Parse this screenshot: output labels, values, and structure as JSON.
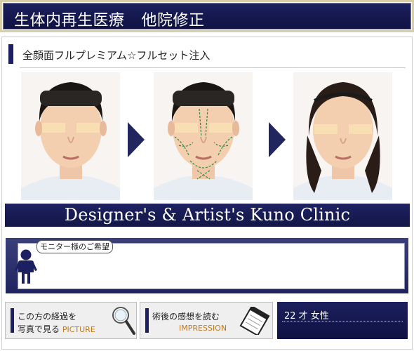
{
  "header": {
    "title_a": "生体内再生医療",
    "title_b": "他院修正"
  },
  "subheading": "全顔面フルプレミアム☆フルセット注入",
  "banner": "Designer's & Artist's Kuno Clinic",
  "wish": {
    "label": "モニター様のご希望",
    "text": ""
  },
  "buttons": {
    "progress": {
      "line1": "この方の経過を",
      "line2": "写真で見る",
      "en": "PICTURE",
      "icon": "magnifier-icon"
    },
    "impression": {
      "line1": "術後の感想を読む",
      "en": "IMPRESSION",
      "icon": "notepad-icon"
    }
  },
  "patient": {
    "info": "22 才 女性"
  },
  "colors": {
    "navy": "#1c2060",
    "accent_text": "#c07a1a",
    "header_frame": "#d8cfa9"
  }
}
